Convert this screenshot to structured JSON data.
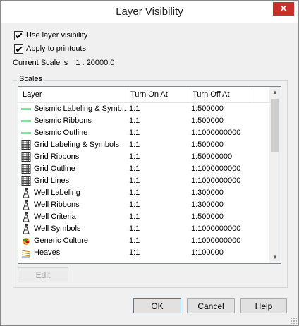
{
  "window": {
    "title": "Layer Visibility",
    "close_glyph": "✕"
  },
  "options": {
    "use_layer_visibility": {
      "label": "Use layer visibility",
      "checked": true
    },
    "apply_to_printouts": {
      "label": "Apply to printouts",
      "checked": true
    }
  },
  "current_scale": {
    "label": "Current Scale is",
    "value": "1 : 20000.0"
  },
  "scales_group": {
    "title": "Scales",
    "columns": [
      "Layer",
      "Turn On At",
      "Turn Off At"
    ],
    "rows": [
      {
        "icon": "seismic-line-icon",
        "layer": "Seismic Labeling & Symb...",
        "on": "1:1",
        "off": "1:500000"
      },
      {
        "icon": "seismic-line-icon",
        "layer": "Seismic Ribbons",
        "on": "1:1",
        "off": "1:500000"
      },
      {
        "icon": "seismic-line-icon",
        "layer": "Seismic Outline",
        "on": "1:1",
        "off": "1:1000000000"
      },
      {
        "icon": "grid-icon",
        "layer": "Grid Labeling & Symbols",
        "on": "1:1",
        "off": "1:500000"
      },
      {
        "icon": "grid-icon",
        "layer": "Grid Ribbons",
        "on": "1:1",
        "off": "1:50000000"
      },
      {
        "icon": "grid-icon",
        "layer": "Grid Outline",
        "on": "1:1",
        "off": "1:1000000000"
      },
      {
        "icon": "grid-icon",
        "layer": "Grid Lines",
        "on": "1:1",
        "off": "1:1000000000"
      },
      {
        "icon": "well-derrick-icon",
        "layer": "Well Labeling",
        "on": "1:1",
        "off": "1:300000"
      },
      {
        "icon": "well-derrick-icon",
        "layer": "Well Ribbons",
        "on": "1:1",
        "off": "1:300000"
      },
      {
        "icon": "well-derrick-icon",
        "layer": "Well Criteria",
        "on": "1:1",
        "off": "1:500000"
      },
      {
        "icon": "well-derrick-icon",
        "layer": "Well Symbols",
        "on": "1:1",
        "off": "1:1000000000"
      },
      {
        "icon": "culture-icon",
        "layer": "Generic Culture",
        "on": "1:1",
        "off": "1:1000000000"
      },
      {
        "icon": "heaves-icon",
        "layer": "Heaves",
        "on": "1:1",
        "off": "1:100000"
      }
    ]
  },
  "buttons": {
    "edit": "Edit",
    "ok": "OK",
    "cancel": "Cancel",
    "help": "Help"
  },
  "colors": {
    "seismic_line": "#22b14c",
    "close_bg": "#c7302b"
  }
}
